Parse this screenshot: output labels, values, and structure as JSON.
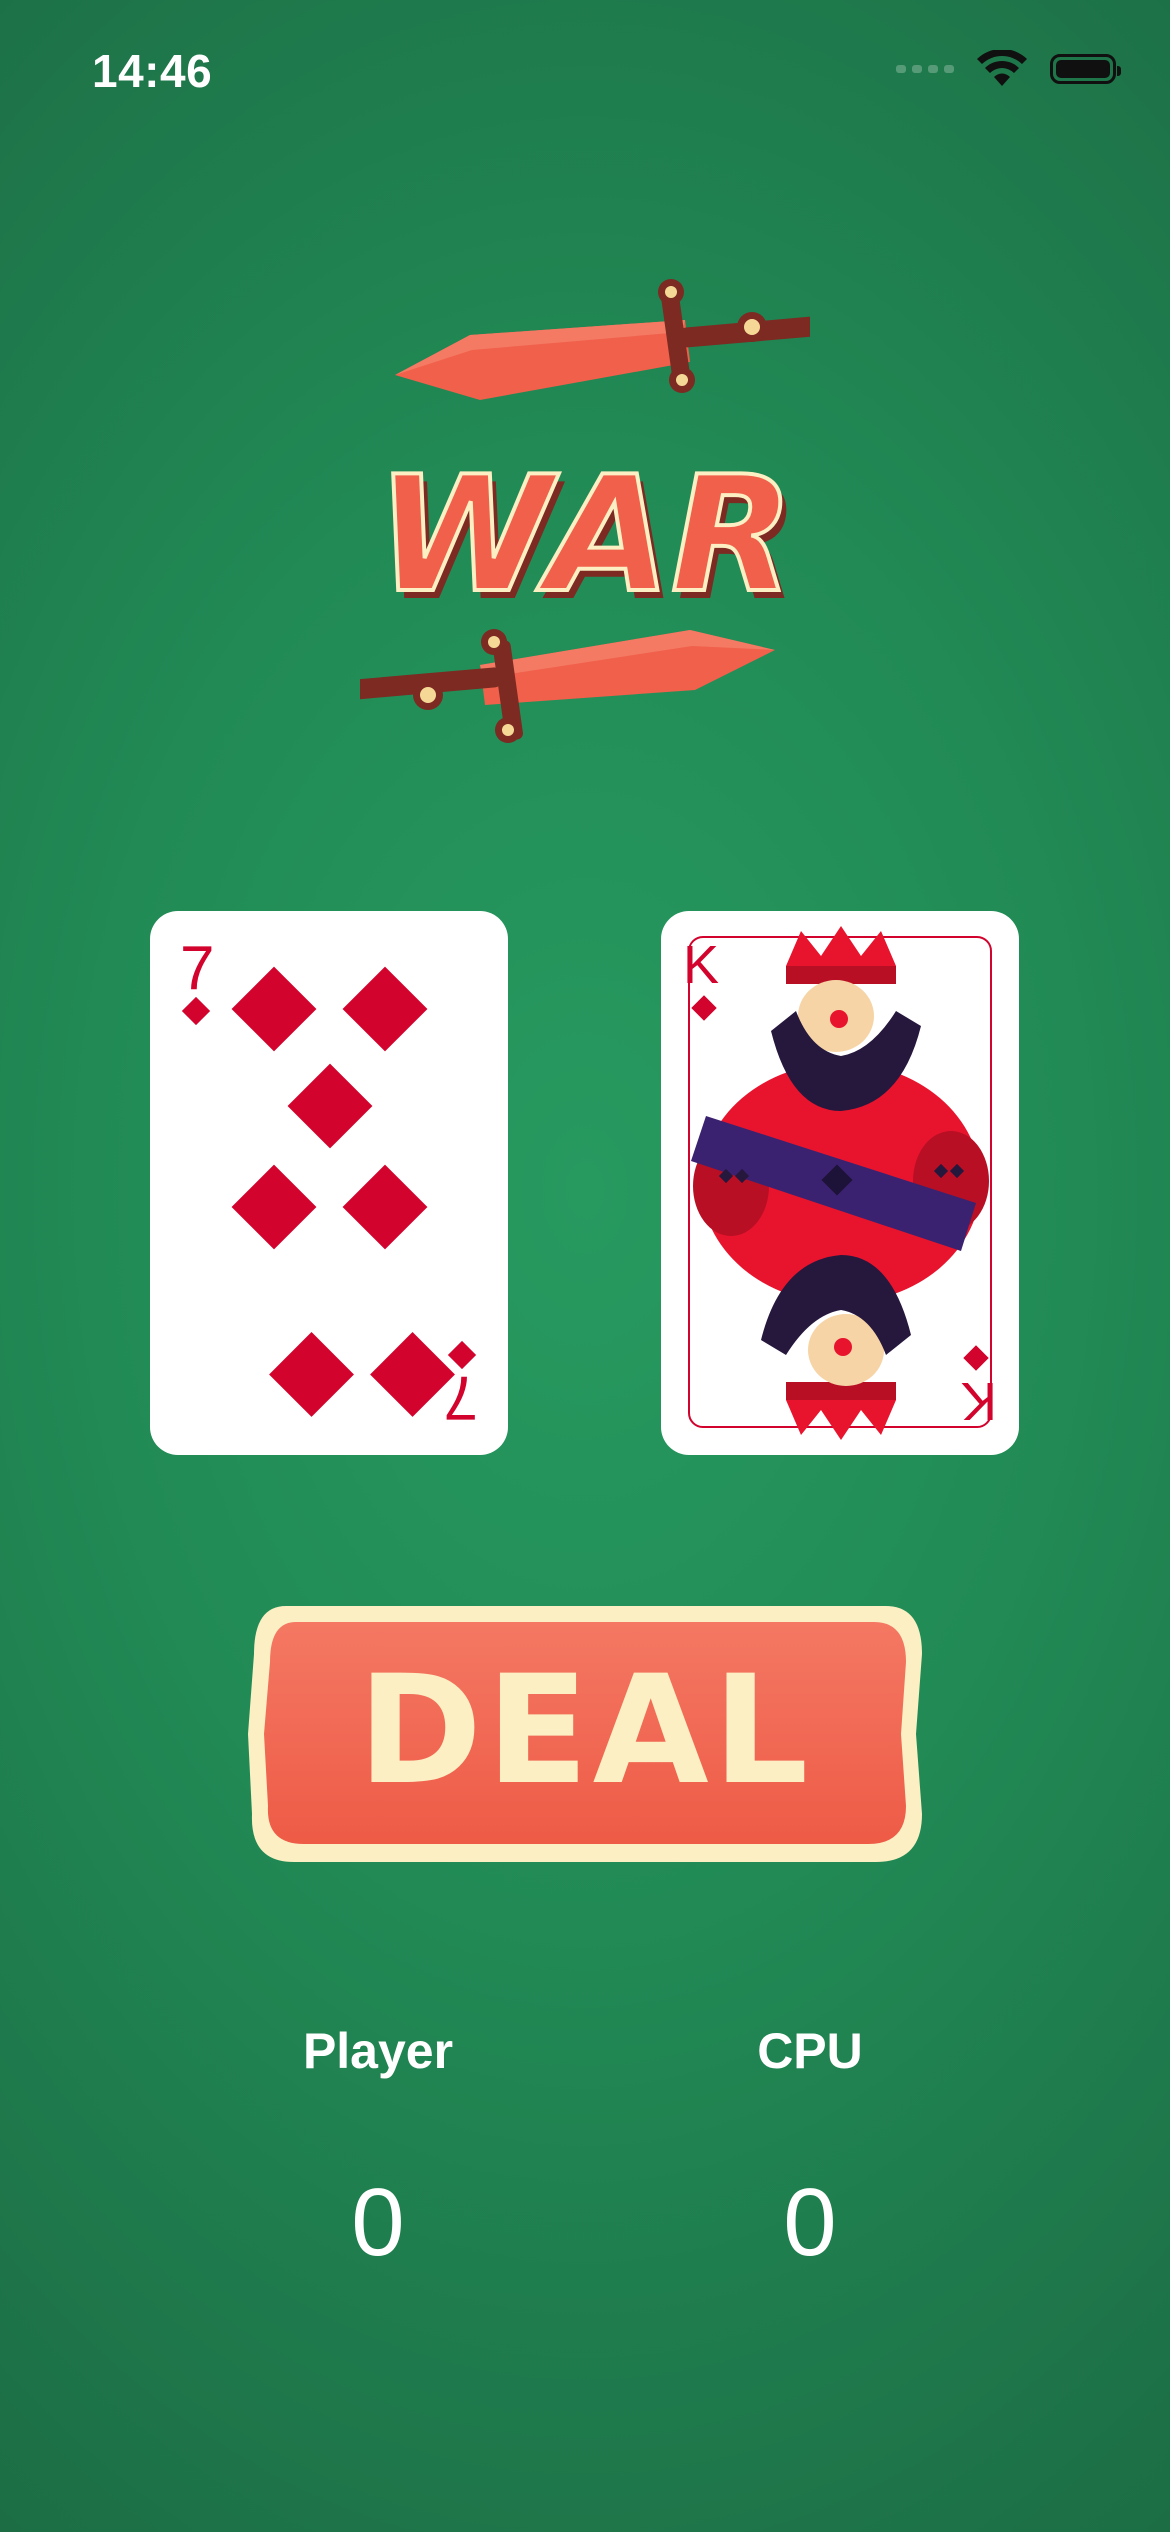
{
  "status_bar": {
    "time": "14:46"
  },
  "logo": {
    "text": "WAR"
  },
  "cards": {
    "player": {
      "rank": "7",
      "suit": "diamonds",
      "color": "#d2032c"
    },
    "cpu": {
      "rank": "K",
      "suit": "diamonds",
      "color": "#d2032c"
    }
  },
  "deal_button": {
    "label": "DEAL"
  },
  "scores": {
    "player_label": "Player",
    "player_score": "0",
    "cpu_label": "CPU",
    "cpu_score": "0"
  },
  "colors": {
    "background": "#248f59",
    "accent": "#f0604b",
    "cream": "#fbefc3",
    "card_red": "#d2032c"
  }
}
